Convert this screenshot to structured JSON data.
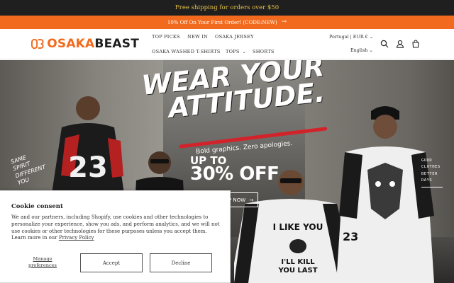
{
  "announcements": {
    "primary": "Free shipping for orders over $50",
    "secondary": "10% Off On Your First Order! (CODE:NEW)"
  },
  "header": {
    "logo_text_a": "OSAKA",
    "logo_text_b": "BEAST",
    "nav": [
      {
        "label": "TOP PICKS"
      },
      {
        "label": "NEW IN"
      },
      {
        "label": "OSAKA JERSEY"
      },
      {
        "label": "OSAKA WASHED T-SHIRTS"
      },
      {
        "label": "TOPS"
      },
      {
        "label": "SHORTS"
      }
    ],
    "country_currency": "Portugal | EUR €",
    "language": "English",
    "icons": [
      "search-icon",
      "account-icon",
      "cart-icon"
    ]
  },
  "hero": {
    "headline_line1": "WEAR YOUR",
    "headline_line2": "ATTITUDE.",
    "subline": "Bold graphics. Zero apologies.",
    "upto": "UP TO",
    "discount": "30% OFF",
    "cta": "SHOP NOW",
    "side_left": [
      "SAME",
      "SPIRIT",
      "DIFFERENT",
      "YOU"
    ],
    "side_right": [
      "GOOD",
      "CLOTHES",
      "BETTER",
      "DAYS"
    ],
    "jersey_number": "23",
    "shirt_text_1": "I LIKE YOU",
    "shirt_text_2": "I'LL KILL",
    "shirt_text_3": "YOU LAST"
  },
  "cookie": {
    "title": "Cookie consent",
    "body": "We and our partners, including Shopify, use cookies and other technologies to personalize your experience, show you ads, and perform analytics, and we will not use cookies or other technologies for these purposes unless you accept them. Learn more in our ",
    "policy_link": "Privacy Policy",
    "manage": "Manage preferences",
    "accept": "Accept",
    "decline": "Decline"
  },
  "colors": {
    "accent": "#f26a1d",
    "announcement_bg": "#1f1f1f",
    "announcement_text": "#e8c24a",
    "hero_red": "#d2232a"
  }
}
